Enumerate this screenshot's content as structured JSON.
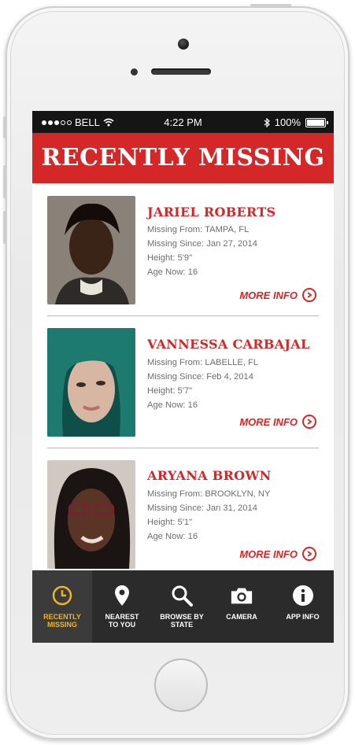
{
  "status_bar": {
    "carrier": "BELL",
    "time": "4:22 PM",
    "battery": "100%"
  },
  "header": {
    "title": "RECENTLY MISSING"
  },
  "people": [
    {
      "name": "JARIEL ROBERTS",
      "missing_from": "Missing From: TAMPA, FL",
      "missing_since": "Missing Since: Jan 27, 2014",
      "height": "Height: 5'9\"",
      "age": "Age Now: 16",
      "more": "MORE INFO"
    },
    {
      "name": "VANNESSA CARBAJAL",
      "missing_from": "Missing From: LABELLE, FL",
      "missing_since": "Missing Since: Feb 4, 2014",
      "height": "Height: 5'7\"",
      "age": "Age Now: 16",
      "more": "MORE INFO"
    },
    {
      "name": "ARYANA BROWN",
      "missing_from": "Missing From: BROOKLYN, NY",
      "missing_since": "Missing Since: Jan 31, 2014",
      "height": "Height: 5'1\"",
      "age": "Age Now: 16",
      "more": "MORE INFO"
    }
  ],
  "tabs": [
    {
      "label_1": "RECENTLY",
      "label_2": "MISSING",
      "icon": "clock-icon",
      "active": true
    },
    {
      "label_1": "NEAREST",
      "label_2": "TO YOU",
      "icon": "map-pin-icon",
      "active": false
    },
    {
      "label_1": "BROWSE BY",
      "label_2": "STATE",
      "icon": "search-icon",
      "active": false
    },
    {
      "label_1": "CAMERA",
      "label_2": "",
      "icon": "camera-icon",
      "active": false
    },
    {
      "label_1": "APP INFO",
      "label_2": "",
      "icon": "info-icon",
      "active": false
    }
  ],
  "colors": {
    "brand_red": "#d42728",
    "tab_active": "#f0b429",
    "tab_bg": "#2b2b2b"
  }
}
